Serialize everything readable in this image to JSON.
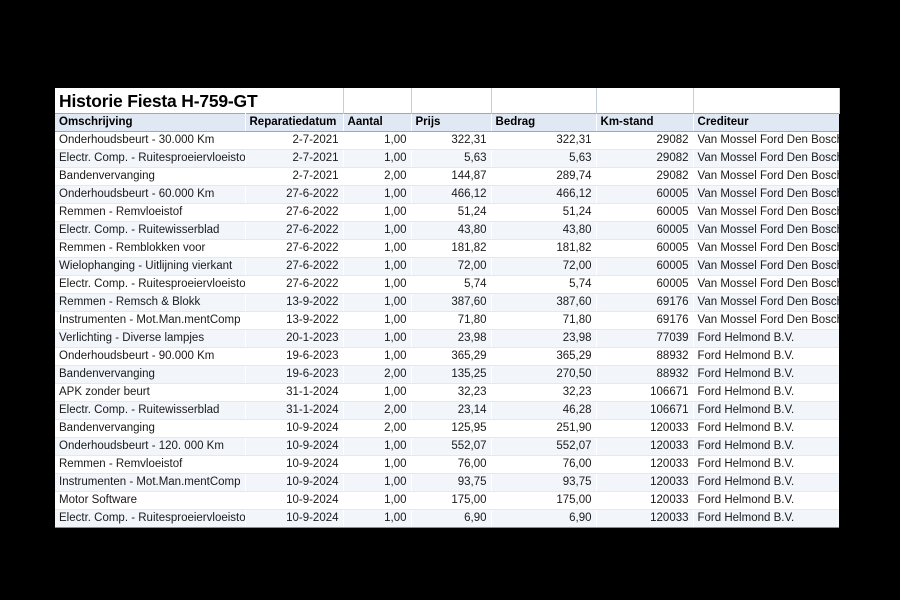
{
  "report": {
    "title": "Historie Fiesta H-759-GT",
    "columns": [
      {
        "key": "omschrijving",
        "label": "Omschrijving",
        "align": "left"
      },
      {
        "key": "reparatiedatum",
        "label": "Reparatiedatum",
        "align": "right"
      },
      {
        "key": "aantal",
        "label": "Aantal",
        "align": "right"
      },
      {
        "key": "prijs",
        "label": "Prijs",
        "align": "right"
      },
      {
        "key": "bedrag",
        "label": "Bedrag",
        "align": "right"
      },
      {
        "key": "km_stand",
        "label": "Km-stand",
        "align": "right"
      },
      {
        "key": "crediteur",
        "label": "Crediteur",
        "align": "left"
      }
    ],
    "rows": [
      {
        "omschrijving": "Onderhoudsbeurt - 30.000 Km",
        "reparatiedatum": "2-7-2021",
        "aantal": "1,00",
        "prijs": "322,31",
        "bedrag": "322,31",
        "km_stand": "29082",
        "crediteur": "Van Mossel Ford Den Bosch"
      },
      {
        "omschrijving": "Electr. Comp. - Ruitesproeiervloeistof",
        "reparatiedatum": "2-7-2021",
        "aantal": "1,00",
        "prijs": "5,63",
        "bedrag": "5,63",
        "km_stand": "29082",
        "crediteur": "Van Mossel Ford Den Bosch"
      },
      {
        "omschrijving": "Bandenvervanging",
        "reparatiedatum": "2-7-2021",
        "aantal": "2,00",
        "prijs": "144,87",
        "bedrag": "289,74",
        "km_stand": "29082",
        "crediteur": "Van Mossel Ford Den Bosch"
      },
      {
        "omschrijving": "Onderhoudsbeurt - 60.000 Km",
        "reparatiedatum": "27-6-2022",
        "aantal": "1,00",
        "prijs": "466,12",
        "bedrag": "466,12",
        "km_stand": "60005",
        "crediteur": "Van Mossel Ford Den Bosch"
      },
      {
        "omschrijving": "Remmen - Remvloeistof",
        "reparatiedatum": "27-6-2022",
        "aantal": "1,00",
        "prijs": "51,24",
        "bedrag": "51,24",
        "km_stand": "60005",
        "crediteur": "Van Mossel Ford Den Bosch"
      },
      {
        "omschrijving": "Electr. Comp. - Ruitewisserblad",
        "reparatiedatum": "27-6-2022",
        "aantal": "1,00",
        "prijs": "43,80",
        "bedrag": "43,80",
        "km_stand": "60005",
        "crediteur": "Van Mossel Ford Den Bosch"
      },
      {
        "omschrijving": "Remmen - Remblokken voor",
        "reparatiedatum": "27-6-2022",
        "aantal": "1,00",
        "prijs": "181,82",
        "bedrag": "181,82",
        "km_stand": "60005",
        "crediteur": "Van Mossel Ford Den Bosch"
      },
      {
        "omschrijving": "Wielophanging - Uitlijning vierkant",
        "reparatiedatum": "27-6-2022",
        "aantal": "1,00",
        "prijs": "72,00",
        "bedrag": "72,00",
        "km_stand": "60005",
        "crediteur": "Van Mossel Ford Den Bosch"
      },
      {
        "omschrijving": "Electr. Comp. - Ruitesproeiervloeistof",
        "reparatiedatum": "27-6-2022",
        "aantal": "1,00",
        "prijs": "5,74",
        "bedrag": "5,74",
        "km_stand": "60005",
        "crediteur": "Van Mossel Ford Den Bosch"
      },
      {
        "omschrijving": "Remmen - Remsch & Blokk",
        "reparatiedatum": "13-9-2022",
        "aantal": "1,00",
        "prijs": "387,60",
        "bedrag": "387,60",
        "km_stand": "69176",
        "crediteur": "Van Mossel Ford Den Bosch"
      },
      {
        "omschrijving": "Instrumenten - Mot.Man.mentComp",
        "reparatiedatum": "13-9-2022",
        "aantal": "1,00",
        "prijs": "71,80",
        "bedrag": "71,80",
        "km_stand": "69176",
        "crediteur": "Van Mossel Ford Den Bosch"
      },
      {
        "omschrijving": "Verlichting - Diverse lampjes",
        "reparatiedatum": "20-1-2023",
        "aantal": "1,00",
        "prijs": "23,98",
        "bedrag": "23,98",
        "km_stand": "77039",
        "crediteur": "Ford Helmond B.V."
      },
      {
        "omschrijving": "Onderhoudsbeurt - 90.000 Km",
        "reparatiedatum": "19-6-2023",
        "aantal": "1,00",
        "prijs": "365,29",
        "bedrag": "365,29",
        "km_stand": "88932",
        "crediteur": "Ford Helmond B.V."
      },
      {
        "omschrijving": "Bandenvervanging",
        "reparatiedatum": "19-6-2023",
        "aantal": "2,00",
        "prijs": "135,25",
        "bedrag": "270,50",
        "km_stand": "88932",
        "crediteur": "Ford Helmond B.V."
      },
      {
        "omschrijving": "APK zonder beurt",
        "reparatiedatum": "31-1-2024",
        "aantal": "1,00",
        "prijs": "32,23",
        "bedrag": "32,23",
        "km_stand": "106671",
        "crediteur": "Ford Helmond B.V."
      },
      {
        "omschrijving": "Electr. Comp. - Ruitewisserblad",
        "reparatiedatum": "31-1-2024",
        "aantal": "2,00",
        "prijs": "23,14",
        "bedrag": "46,28",
        "km_stand": "106671",
        "crediteur": "Ford Helmond B.V."
      },
      {
        "omschrijving": "Bandenvervanging",
        "reparatiedatum": "10-9-2024",
        "aantal": "2,00",
        "prijs": "125,95",
        "bedrag": "251,90",
        "km_stand": "120033",
        "crediteur": "Ford Helmond B.V."
      },
      {
        "omschrijving": "Onderhoudsbeurt - 120. 000 Km",
        "reparatiedatum": "10-9-2024",
        "aantal": "1,00",
        "prijs": "552,07",
        "bedrag": "552,07",
        "km_stand": "120033",
        "crediteur": "Ford Helmond B.V."
      },
      {
        "omschrijving": "Remmen - Remvloeistof",
        "reparatiedatum": "10-9-2024",
        "aantal": "1,00",
        "prijs": "76,00",
        "bedrag": "76,00",
        "km_stand": "120033",
        "crediteur": "Ford Helmond B.V."
      },
      {
        "omschrijving": "Instrumenten - Mot.Man.mentComp",
        "reparatiedatum": "10-9-2024",
        "aantal": "1,00",
        "prijs": "93,75",
        "bedrag": "93,75",
        "km_stand": "120033",
        "crediteur": "Ford Helmond B.V."
      },
      {
        "omschrijving": "Motor Software",
        "reparatiedatum": "10-9-2024",
        "aantal": "1,00",
        "prijs": "175,00",
        "bedrag": "175,00",
        "km_stand": "120033",
        "crediteur": "Ford Helmond B.V."
      },
      {
        "omschrijving": "Electr. Comp. - Ruitesproeiervloeistof",
        "reparatiedatum": "10-9-2024",
        "aantal": "1,00",
        "prijs": "6,90",
        "bedrag": "6,90",
        "km_stand": "120033",
        "crediteur": "Ford Helmond B.V."
      }
    ]
  },
  "colors": {
    "page_background": "#000000",
    "panel_background": "#ffffff",
    "header_background": "#dfe8f3",
    "row_stripe": "#f2f6fb",
    "grid_line": "#c3cedd",
    "text": "#1a1a1a"
  }
}
